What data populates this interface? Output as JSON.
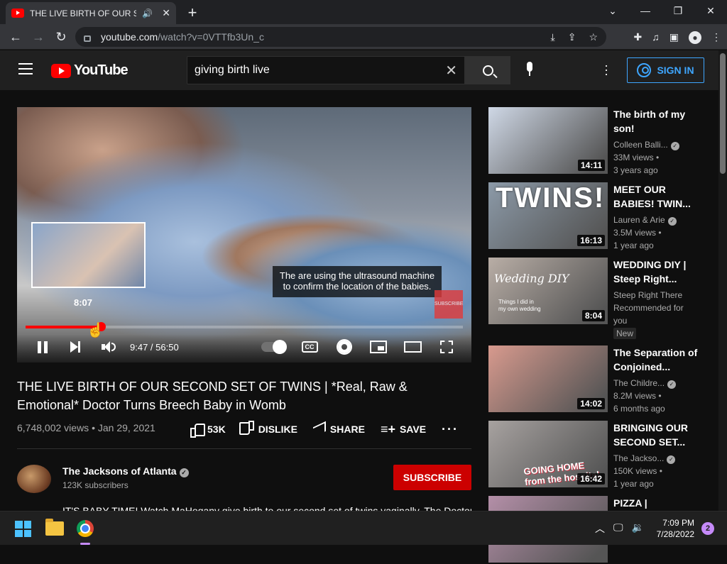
{
  "browser": {
    "tab_title": "THE LIVE BIRTH OF OUR SEC",
    "url_host": "youtube.com",
    "url_path": "/watch?v=0VTTfb3Un_c"
  },
  "header": {
    "logo_text": "YouTube",
    "search_value": "giving birth live",
    "sign_in": "SIGN IN"
  },
  "player": {
    "caption_line1": "The are using the ultrasound machine",
    "caption_line2": "to confirm the location of the babies.",
    "preview_time": "8:07",
    "time": "9:47 / 56:50",
    "played_fraction": 0.172,
    "cc_label": "CC",
    "watermark": "SUBSCRIBE"
  },
  "video": {
    "title": "THE LIVE BIRTH OF OUR SECOND SET OF TWINS | *Real, Raw & Emotional* Doctor Turns Breech Baby in Womb",
    "views_date": "6,748,002 views • Jan 29, 2021",
    "likes": "53K",
    "dislike": "DISLIKE",
    "share": "SHARE",
    "save": "SAVE",
    "channel": "The Jacksons of Atlanta",
    "subscribers": "123K subscribers",
    "subscribe": "SUBSCRIBE",
    "description": "IT'S BABY TIME! Watch MaHogany give birth to our second set of twins vaginally. The Doctor"
  },
  "sidebar": [
    {
      "title": "The birth of my son!",
      "channel": "Colleen Balli...",
      "verified": true,
      "views": "33M views •",
      "age": "3 years ago",
      "duration": "14:11",
      "thumb_color": "#cfd8e6"
    },
    {
      "title": "MEET OUR BABIES! TWIN...",
      "channel": "Lauren & Arie",
      "verified": true,
      "views": "3.5M views •",
      "age": "1 year ago",
      "duration": "16:13",
      "thumb_color": "#8c9aa8",
      "thumb_text": "TWINS!"
    },
    {
      "title": "WEDDING DIY | Steep Right...",
      "channel": "Steep Right There",
      "verified": false,
      "views": "Recommended for",
      "age": "you",
      "badge": "New",
      "duration": "8:04",
      "thumb_color": "#b9aea6",
      "thumb_text": "Wedding DIY",
      "thumb_subtext": "Things I did in my own wedding"
    },
    {
      "title": "The Separation of Conjoined...",
      "channel": "The Childre...",
      "verified": true,
      "views": "8.2M views •",
      "age": "6 months ago",
      "duration": "14:02",
      "thumb_color": "#d89a8e"
    },
    {
      "title": "BRINGING OUR SECOND SET...",
      "channel": "The Jackso...",
      "verified": true,
      "views": "150K views •",
      "age": "1 year ago",
      "duration": "16:42",
      "thumb_color": "#a7a2a0",
      "thumb_text": "GOING HOME from the hospital"
    },
    {
      "title": "PIZZA |",
      "thumb_color": "#b48fa8"
    }
  ],
  "taskbar": {
    "time": "7:09 PM",
    "date": "7/28/2022",
    "notifications": "2"
  }
}
